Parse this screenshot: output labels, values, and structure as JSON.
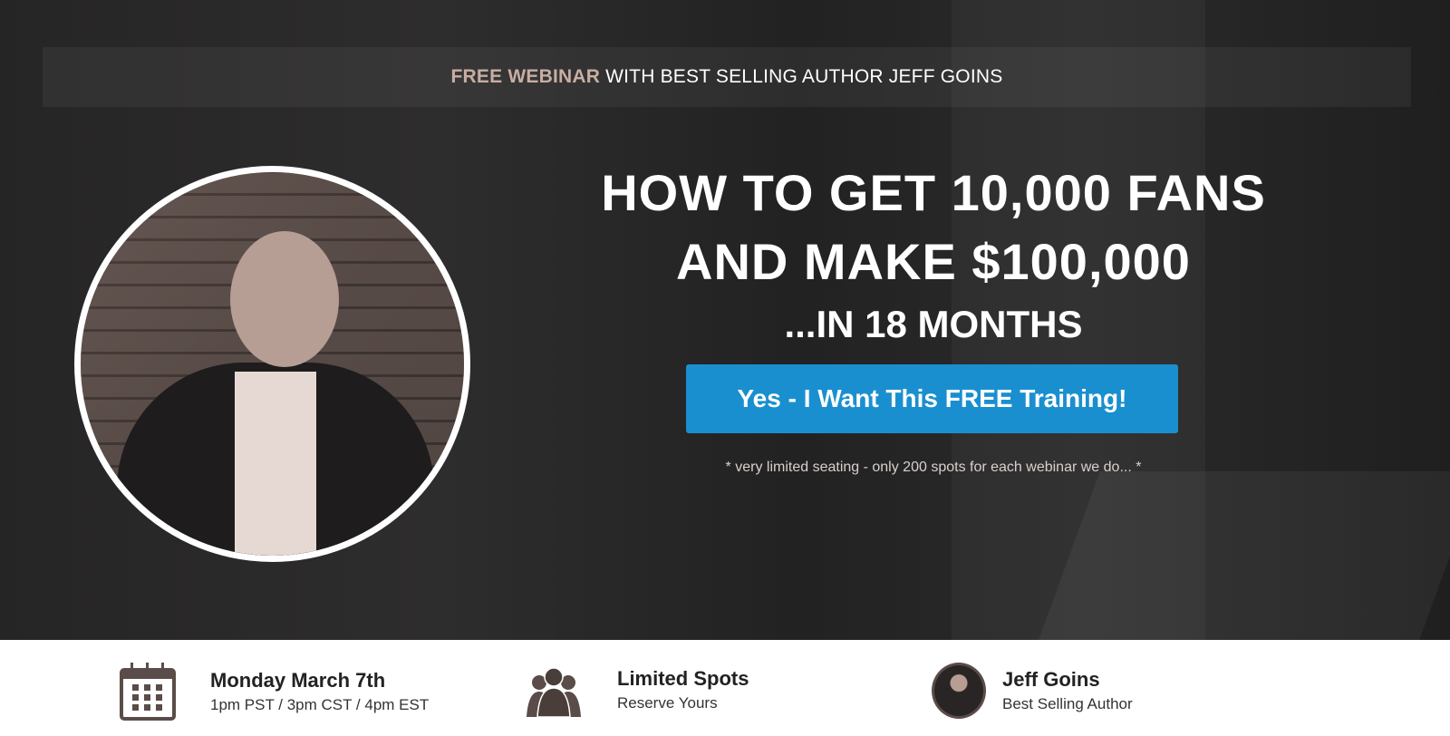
{
  "banner": {
    "highlight": "FREE WEBINAR",
    "rest": "WITH BEST SELLING AUTHOR JEFF GOINS"
  },
  "headline": {
    "line1": "HOW TO GET 10,000 FANS",
    "line2": "AND MAKE $100,000",
    "line3": "...IN 18 MONTHS"
  },
  "cta": {
    "label": "Yes - I Want This FREE Training!",
    "color": "#1a8fd0"
  },
  "note": "* very limited seating - only 200 spots for each webinar we do... *",
  "info": [
    {
      "icon": "calendar-icon",
      "title": "Monday March 7th",
      "subtitle": "1pm PST / 3pm CST / 4pm EST"
    },
    {
      "icon": "group-icon",
      "title": "Limited Spots",
      "subtitle": "Reserve Yours"
    },
    {
      "icon": "author-avatar",
      "title": "Jeff Goins",
      "subtitle": "Best Selling Author"
    }
  ]
}
